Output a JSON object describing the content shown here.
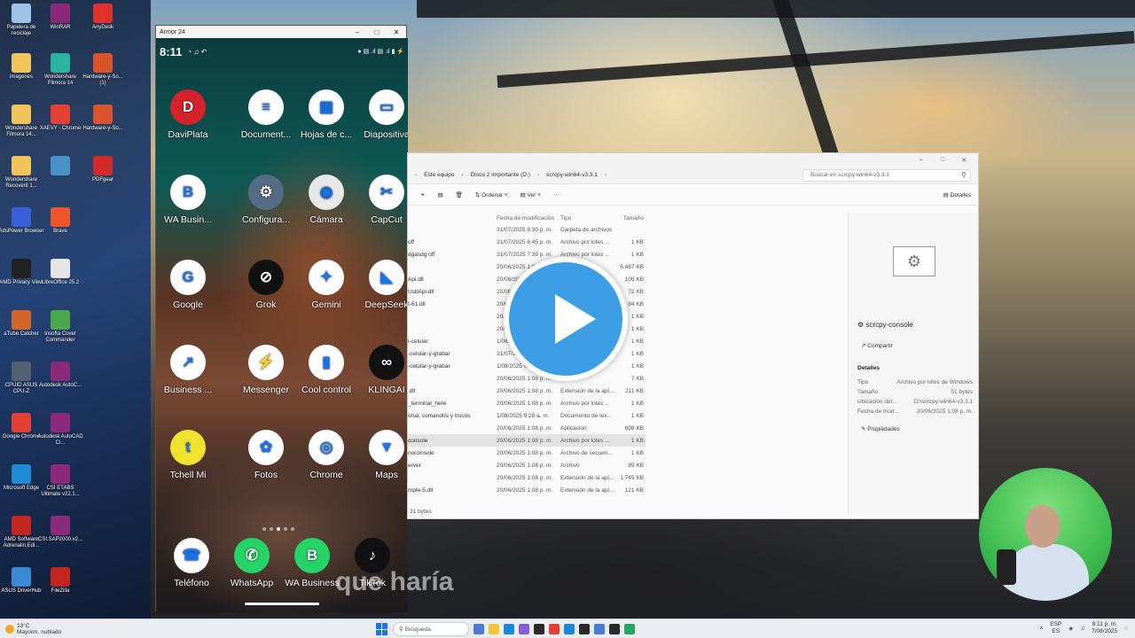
{
  "desktop_icons": [
    {
      "label": "Papelera de reciclaje",
      "color": "#9ec3e6"
    },
    {
      "label": "WinRAR",
      "color": "#8b2a7b"
    },
    {
      "label": "AnyDesk",
      "color": "#e0322d"
    },
    {
      "label": "imagenes",
      "color": "#f0c45a"
    },
    {
      "label": "Wondershare Filmora 14",
      "color": "#2bb5a0"
    },
    {
      "label": "Hardware-y-So... (1)",
      "color": "#d9542a"
    },
    {
      "label": "Wondershare Filmora 14...",
      "color": "#f0c45a"
    },
    {
      "label": "XAEVY - Chrome",
      "color": "#e34133"
    },
    {
      "label": "Hardware-y-So...",
      "color": "#d9542a"
    },
    {
      "label": "Wondershare Recoverit 1...",
      "color": "#f0c45a"
    },
    {
      "label": "",
      "color": "#4a90c9"
    },
    {
      "label": "PDFgear",
      "color": "#d42a2a"
    },
    {
      "label": "AdsPower Browser",
      "color": "#3a5fd9"
    },
    {
      "label": "Brave",
      "color": "#f0552c"
    },
    {
      "label": "AMD Privacy View",
      "color": "#222222"
    },
    {
      "label": "LibreOffice 25.2",
      "color": "#e6e6e6"
    },
    {
      "label": "aTube Catcher",
      "color": "#d4652a"
    },
    {
      "label": "Insofta Cover Commander",
      "color": "#4aa84a"
    },
    {
      "label": "CPUID ASUS CPU-Z",
      "color": "#556070"
    },
    {
      "label": "Autodesk AutoC...",
      "color": "#8b2a7b"
    },
    {
      "label": "Google Chrome",
      "color": "#e34133"
    },
    {
      "label": "Autodesk AutoCAD Ci...",
      "color": "#8b2a7b"
    },
    {
      "label": "Microsoft Edge",
      "color": "#1c8ad6"
    },
    {
      "label": "CSI ETABS Ultimate v22.1...",
      "color": "#8b2a7b"
    },
    {
      "label": "AMD Software Adrenalin Edi...",
      "color": "#c3261e"
    },
    {
      "label": "CSI.SAP2000.v2...",
      "color": "#8b2a7b"
    },
    {
      "label": "ASUS DriverHub",
      "color": "#3a8ad6"
    },
    {
      "label": "FileZilla",
      "color": "#c3261e"
    }
  ],
  "phone": {
    "window_title": "Armor 24",
    "time": "8:11",
    "apps": [
      {
        "label": "DaviPlata",
        "color": "#d6222a",
        "glyph": "D"
      },
      {
        "label": "Document...",
        "color": "#ffffff",
        "glyph": "≡"
      },
      {
        "label": "Hojas de c...",
        "color": "#ffffff",
        "glyph": "▦"
      },
      {
        "label": "Diapositiva",
        "color": "#ffffff",
        "glyph": "▭"
      },
      {
        "label": "WA Busin...",
        "color": "#ffffff",
        "glyph": "B"
      },
      {
        "label": "Configura...",
        "color": "#566b86",
        "glyph": "⚙"
      },
      {
        "label": "Cámara",
        "color": "#e8e8e8",
        "glyph": "◉"
      },
      {
        "label": "CapCut",
        "color": "#ffffff",
        "glyph": "✂"
      },
      {
        "label": "Google",
        "color": "#ffffff",
        "glyph": "G"
      },
      {
        "label": "Grok",
        "color": "#111111",
        "glyph": "⊘"
      },
      {
        "label": "Gemini",
        "color": "#ffffff",
        "glyph": "✦"
      },
      {
        "label": "DeepSeek",
        "color": "#ffffff",
        "glyph": "◣"
      },
      {
        "label": "Business ...",
        "color": "#ffffff",
        "glyph": "↗"
      },
      {
        "label": "Messenger",
        "color": "#ffffff",
        "glyph": "⚡"
      },
      {
        "label": "Cool control",
        "color": "#ffffff",
        "glyph": "▮"
      },
      {
        "label": "KLINGAI",
        "color": "#111111",
        "glyph": "∞"
      },
      {
        "label": "Tchell Mi",
        "color": "#f2e230",
        "glyph": "t"
      },
      {
        "label": "Fotos",
        "color": "#ffffff",
        "glyph": "✿"
      },
      {
        "label": "Chrome",
        "color": "#ffffff",
        "glyph": "◎"
      },
      {
        "label": "Maps",
        "color": "#ffffff",
        "glyph": "▼"
      }
    ],
    "dock": [
      {
        "label": "Teléfono",
        "color": "#ffffff",
        "glyph": "☎"
      },
      {
        "label": "WhatsApp",
        "color": "#25d366",
        "glyph": "✆"
      },
      {
        "label": "WA Business",
        "color": "#25d366",
        "glyph": "B"
      },
      {
        "label": "TikTok",
        "color": "#111111",
        "glyph": "♪"
      }
    ]
  },
  "explorer": {
    "breadcrumb": [
      "Este equipo",
      "Disco 2 Importante (D:)",
      "scrcpy-win64-v3.3.1"
    ],
    "search_placeholder": "Buscar en scrcpy-win64-v3.3.1",
    "toolbar": {
      "sort": "Ordenar",
      "view": "Ver",
      "more": "···",
      "details": "Detalles"
    },
    "columns": {
      "date": "Fecha de modificación",
      "type": "Tipo",
      "size": "Tamaño"
    },
    "rows": [
      {
        "name": "",
        "date": "31/07/2025 8:30 p. m.",
        "type": "Carpeta de archivos",
        "size": ""
      },
      {
        "name": "off",
        "date": "31/07/2025 6:45 p. m.",
        "type": "Archivo por lotes ...",
        "size": "1 KB"
      },
      {
        "name": "dgasdg off",
        "date": "31/07/2025 7:39 p. m.",
        "type": "Archivo por lotes ...",
        "size": "1 KB"
      },
      {
        "name": "",
        "date": "20/06/2025 1:08 p. m.",
        "type": "",
        "size": "6.487 KB"
      },
      {
        "name": "Api.dll",
        "date": "20/06/2025 1:08 p. m.",
        "type": "",
        "size": "106 KB"
      },
      {
        "name": "UsbApi.dll",
        "date": "20/06/2025 1:08 p. m.",
        "type": "",
        "size": "72 KB"
      },
      {
        "name": "t-61.dll",
        "date": "20/06/2025 1:08 p. m.",
        "type": "",
        "size": "84 KB"
      },
      {
        "name": "",
        "date": "20/06/2025 1:08 p. m.",
        "type": "",
        "size": "1 KB"
      },
      {
        "name": "",
        "date": "20/06/2025 1:08 p. m.",
        "type": "",
        "size": "1 KB"
      },
      {
        "name": "i-celular",
        "date": "1/08/2025 9:28 a. m.",
        "type": "",
        "size": "1 KB"
      },
      {
        "name": "-celular-y-grabar",
        "date": "31/07/2025 7:39 p. m.",
        "type": "",
        "size": "1 KB"
      },
      {
        "name": "-celular-y-grabar",
        "date": "1/08/2025 9:28 a. m.",
        "type": "",
        "size": "1 KB"
      },
      {
        "name": "",
        "date": "20/06/2025 1:08 p. m.",
        "type": "",
        "size": "7 KB"
      },
      {
        "name": ".dll",
        "date": "20/06/2025 1:08 p. m.",
        "type": "Extensión de la apl...",
        "size": "211 KB"
      },
      {
        "name": "_terminal_here",
        "date": "20/06/2025 1:08 p. m.",
        "type": "Archivo por lotes ...",
        "size": "1 KB"
      },
      {
        "name": "orial, comandos y trucos",
        "date": "1/08/2025 9:28 a. m.",
        "type": "Documento de tex...",
        "size": "1 KB"
      },
      {
        "name": "",
        "date": "20/06/2025 1:08 p. m.",
        "type": "Aplicación",
        "size": "698 KB"
      },
      {
        "name": "console",
        "date": "20/06/2025 1:08 p. m.",
        "type": "Archivo por lotes ...",
        "size": "1 KB",
        "selected": true
      },
      {
        "name": "noconsole",
        "date": "20/06/2025 1:08 p. m.",
        "type": "Archivo de secuen...",
        "size": "1 KB"
      },
      {
        "name": "erver",
        "date": "20/06/2025 1:08 p. m.",
        "type": "Archivo",
        "size": "89 KB"
      },
      {
        "name": "",
        "date": "20/06/2025 1:08 p. m.",
        "type": "Extensión de la apl...",
        "size": "1.745 KB"
      },
      {
        "name": "mple-5.dll",
        "date": "20/06/2025 1:08 p. m.",
        "type": "Extensión de la apl...",
        "size": "121 KB"
      }
    ],
    "footer": "31 bytes",
    "details": {
      "file_name": "scrcpy-console",
      "share": "Compartir",
      "section": "Detalles",
      "fields": [
        {
          "k": "Tipo",
          "v": "Archivo por lotes de Windows"
        },
        {
          "k": "Tamaño",
          "v": "51 bytes"
        },
        {
          "k": "Ubicación del...",
          "v": "D:\\scrcpy-win64-v3.3.1"
        },
        {
          "k": "Fecha de mod...",
          "v": "20/06/2025 1:08 p. m."
        }
      ],
      "properties": "Propiedades"
    }
  },
  "subtitle": "que haría",
  "taskbar": {
    "weather_temp": "13°C",
    "weather_desc": "Mayorm. nublado",
    "search_placeholder": "Búsqueda",
    "lang_top": "ESP",
    "lang_bottom": "ES",
    "time": "8:11 p. m.",
    "date": "7/08/2025",
    "app_colors": [
      "#4a7bd0",
      "#f2c438",
      "#1c8ad6",
      "#8a5bd6",
      "#2b2b2b",
      "#e34133",
      "#1c8ad6",
      "#2a2a2a",
      "#4a7bd0",
      "#2a2a2a",
      "#25a55f"
    ]
  }
}
